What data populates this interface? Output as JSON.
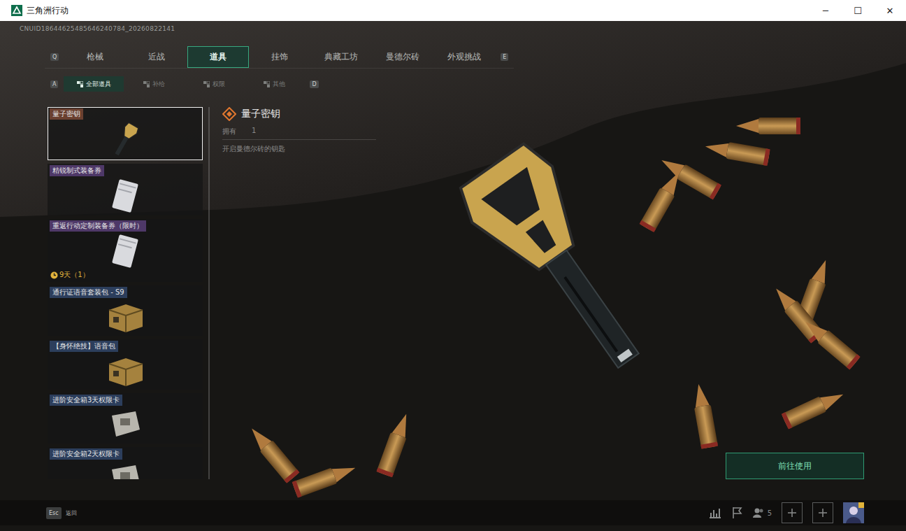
{
  "window": {
    "title": "三角洲行动",
    "controls": [
      "─",
      "☐",
      "✕"
    ]
  },
  "uid": "CNUID18644625485646240784_20260822141",
  "main_tabs": {
    "prev_key": "Q",
    "next_key": "E",
    "items": [
      {
        "label": "枪械",
        "selected": false
      },
      {
        "label": "近战",
        "selected": false
      },
      {
        "label": "道具",
        "selected": true
      },
      {
        "label": "挂饰",
        "selected": false
      },
      {
        "label": "典藏工坊",
        "selected": false
      },
      {
        "label": "曼德尔砖",
        "selected": false
      },
      {
        "label": "外观挑战",
        "selected": false
      }
    ]
  },
  "sub_tabs": {
    "prev_key": "A",
    "next_key": "D",
    "items": [
      {
        "label": "全部道具",
        "selected": true
      },
      {
        "label": "补给",
        "selected": false
      },
      {
        "label": "权限",
        "selected": false
      },
      {
        "label": "其他",
        "selected": false
      }
    ]
  },
  "items": [
    {
      "name": "量子密钥",
      "selected": true,
      "color": "#6a4030",
      "kind": "key",
      "timer": ""
    },
    {
      "name": "精锐制式装备券",
      "selected": false,
      "color": "#4e3868",
      "kind": "voucher",
      "timer": ""
    },
    {
      "name": "重返行动定制装备券（限时）",
      "selected": false,
      "color": "#4e3868",
      "kind": "voucher",
      "timer": "9天（1）"
    },
    {
      "name": "通行证语音套装包 - S9",
      "selected": false,
      "color": "#2c3e5c",
      "kind": "box",
      "timer": ""
    },
    {
      "name": "【身怀绝技】语音包",
      "selected": false,
      "color": "#2c3e5c",
      "kind": "box",
      "timer": ""
    },
    {
      "name": "进阶安全箱3天权限卡",
      "selected": false,
      "color": "#2c3e5c",
      "kind": "card",
      "timer": ""
    },
    {
      "name": "进阶安全箱2天权限卡",
      "selected": false,
      "color": "#2c3e5c",
      "kind": "card",
      "timer": ""
    }
  ],
  "detail": {
    "title": "量子密钥",
    "owned_label": "拥有",
    "owned": "1",
    "description": "开启曼德尔砖的钥匙",
    "action": "前往使用"
  },
  "footer": {
    "back_key": "Esc",
    "back_label": "返回",
    "friends": "5"
  }
}
